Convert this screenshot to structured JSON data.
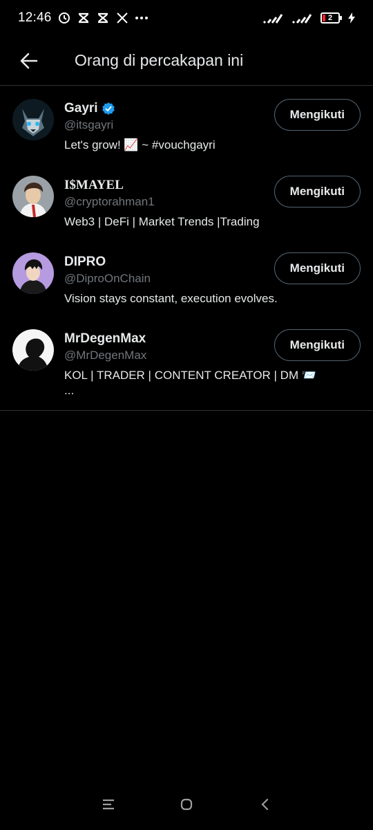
{
  "status_bar": {
    "time": "12:46",
    "battery_level": "2",
    "icons": [
      "alarm-icon",
      "capcut-icon",
      "capcut-icon",
      "x-logo-icon",
      "more-dots-icon",
      "signal-icon",
      "signal-icon",
      "battery-icon",
      "charging-icon"
    ]
  },
  "header": {
    "title": "Orang di percakapan ini",
    "back_icon": "arrow-left-icon"
  },
  "users": [
    {
      "name": "Gayri",
      "verified": true,
      "handle": "@itsgayri",
      "bio": "Let's grow! 📈 ~ #vouchgayri",
      "follow_label": "Mengikuti"
    },
    {
      "name": "I$MAYEL",
      "verified": false,
      "handle": "@cryptorahman1",
      "bio": "Web3 | DeFi | Market Trends |Trading",
      "follow_label": "Mengikuti"
    },
    {
      "name": "DIPRO",
      "verified": false,
      "handle": "@DiproOnChain",
      "bio": "Vision stays constant, execution evolves.",
      "follow_label": "Mengikuti"
    },
    {
      "name": "MrDegenMax",
      "verified": false,
      "handle": "@MrDegenMax",
      "bio": "KOL | TRADER | CONTENT CREATOR | DM 📨",
      "bio_more": "...",
      "follow_label": "Mengikuti"
    }
  ],
  "nav_bar": {
    "icons": [
      "menu-icon",
      "home-icon",
      "back-icon"
    ]
  },
  "colors": {
    "background": "#000000",
    "text_primary": "#e7e9ea",
    "text_secondary": "#71767b",
    "divider": "#2f3336",
    "verified_blue": "#1d9bf0"
  }
}
